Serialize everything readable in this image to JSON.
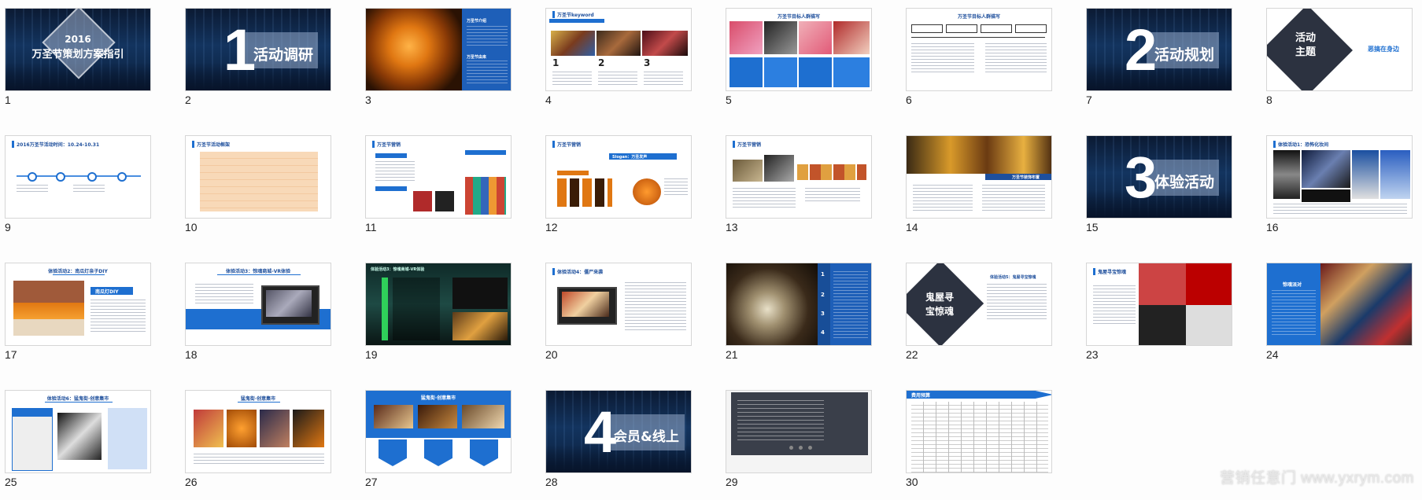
{
  "slides": [
    {
      "num": "1",
      "year": "2016",
      "title": "万圣节策划方案指引"
    },
    {
      "num": "2",
      "big": "1",
      "title": "活动调研"
    },
    {
      "num": "3",
      "side_title": "万圣节介绍",
      "side_sub": "万圣节由来"
    },
    {
      "num": "4",
      "header": "万圣节keyword",
      "k1": "1",
      "k2": "2",
      "k3": "3"
    },
    {
      "num": "5",
      "title": "万圣节目标人群描写"
    },
    {
      "num": "6",
      "title": "万圣节目标人群描写"
    },
    {
      "num": "7",
      "big": "2",
      "title": "活动规划"
    },
    {
      "num": "8",
      "title_a": "活动",
      "title_b": "主题",
      "theme": "恶搞在身边"
    },
    {
      "num": "9",
      "header": "2016万圣节活动时间：10.24-10.31"
    },
    {
      "num": "10",
      "title": "万圣节活动框架"
    },
    {
      "num": "11",
      "title": "万圣节营销"
    },
    {
      "num": "12",
      "title": "万圣节营销",
      "tag": "Slogan：万圣发声"
    },
    {
      "num": "13",
      "title": "万圣节营销"
    },
    {
      "num": "14",
      "label": "万圣节装饰布置"
    },
    {
      "num": "15",
      "big": "3",
      "title": "体验活动"
    },
    {
      "num": "16",
      "header": "体验活动1：恐怖化妆间"
    },
    {
      "num": "17",
      "title": "体验活动2：南瓜灯亲子DIY",
      "tag": "南瓜灯DIY"
    },
    {
      "num": "18",
      "title": "体验活动3：惊魂商城-VR体验"
    },
    {
      "num": "19",
      "header": "体验活动3：惊魂商城-VR体验"
    },
    {
      "num": "20",
      "header": "体验活动4：僵尸来袭"
    },
    {
      "num": "21",
      "steps": [
        "1",
        "2",
        "3",
        "4"
      ]
    },
    {
      "num": "22",
      "title_a": "鬼屋寻",
      "title_b": "宝惊魂",
      "side": "体验活动5：鬼屋寻宝惊魂"
    },
    {
      "num": "23",
      "header": "鬼屋寻宝惊魂"
    },
    {
      "num": "24",
      "tag": "惊魂派对"
    },
    {
      "num": "25",
      "title": "体验活动6：猛鬼街·创意集市"
    },
    {
      "num": "26",
      "title": "猛鬼街·创意集市"
    },
    {
      "num": "27",
      "title": "猛鬼街·创意集市"
    },
    {
      "num": "28",
      "big": "4",
      "title": "会员&线上"
    },
    {
      "num": "29"
    },
    {
      "num": "30",
      "header": "费用预算"
    }
  ],
  "watermark": "营销任意门 www.yxrym.com",
  "colors": {
    "accent": "#1e6fd0",
    "dark_bg": "#0b1a33",
    "panel": "#3a3f4a"
  }
}
